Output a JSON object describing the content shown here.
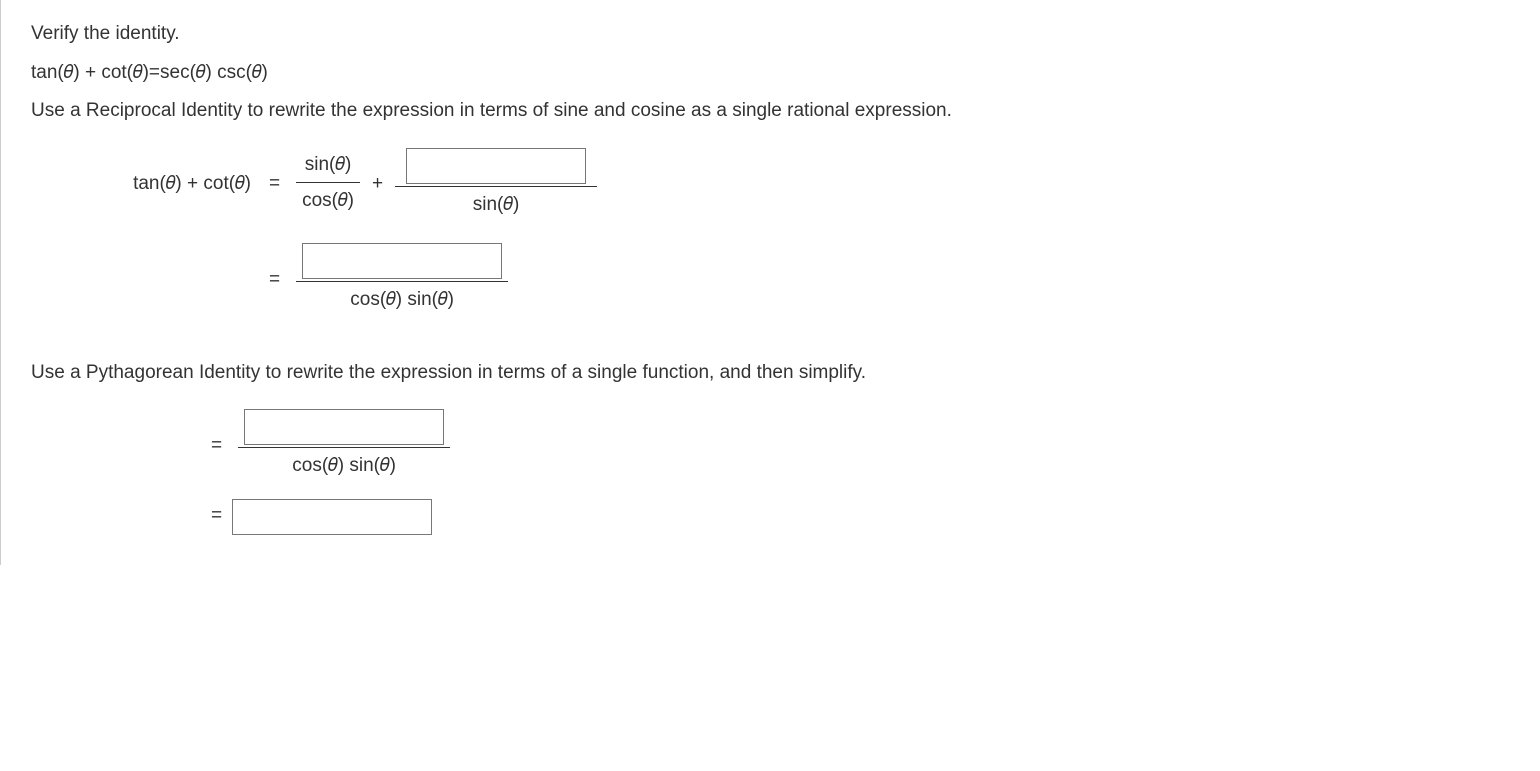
{
  "intro": "Verify the identity.",
  "identity_lhs": "tan(𝜃) + cot(𝜃)",
  "eq": " = ",
  "identity_rhs": "sec(𝜃) csc(𝜃)",
  "step1_instruction": "Use a Reciprocal Identity to rewrite the expression in terms of sine and cosine as a single rational expression.",
  "lhs_expr": "tan(𝜃) + cot(𝜃)",
  "frac1_num": "sin(𝜃)",
  "frac1_den": "cos(𝜃)",
  "plus": "+",
  "frac2_den": "sin(𝜃)",
  "frac3_den": "cos(𝜃) sin(𝜃)",
  "step2_instruction": "Use a Pythagorean Identity to rewrite the expression in terms of a single function, and then simplify.",
  "frac4_den": "cos(𝜃) sin(𝜃)",
  "eq_only": "="
}
